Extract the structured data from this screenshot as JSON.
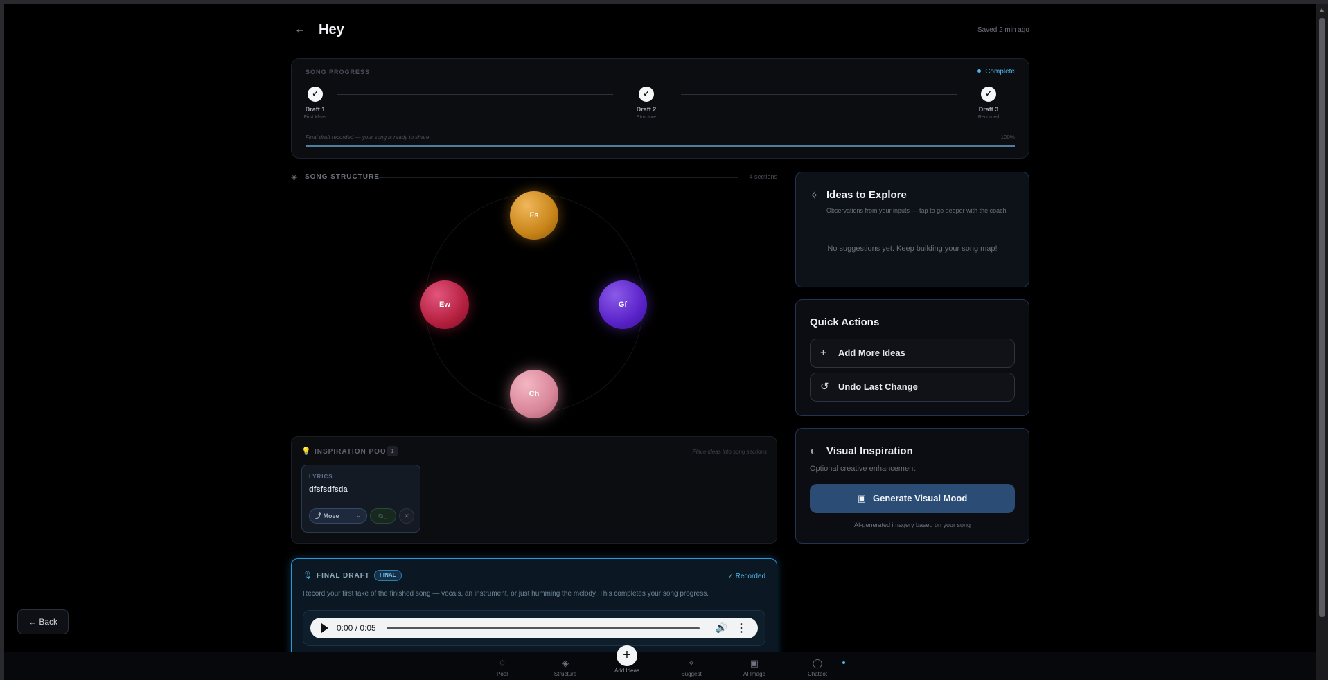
{
  "header": {
    "title": "Hey",
    "saved": "Saved 2 min ago"
  },
  "progress": {
    "label": "SONG PROGRESS",
    "status": "Complete",
    "steps": [
      {
        "name": "Draft 1",
        "sub": "First Ideas",
        "check": "✓"
      },
      {
        "name": "Draft 2",
        "sub": "Structure",
        "check": "✓"
      },
      {
        "name": "Draft 3",
        "sub": "Recorded",
        "check": "✓"
      }
    ],
    "message": "Final draft recorded — your song is ready to share",
    "percent_label": "100%",
    "percent": 100
  },
  "structure": {
    "label": "SONG STRUCTURE",
    "count": "4 sections",
    "sections": [
      {
        "abbr": "Fs",
        "color": "#c88418"
      },
      {
        "abbr": "Ew",
        "color": "#b4203f"
      },
      {
        "abbr": "Gf",
        "color": "#5a22c9"
      },
      {
        "abbr": "Ch",
        "color": "#d8869a"
      }
    ]
  },
  "pool": {
    "label": "INSPIRATION POOL",
    "count": "1",
    "hint": "Place ideas into song sections",
    "items": [
      {
        "type": "LYRICS",
        "text": "dfsfsdfsda",
        "move_label": "Move"
      }
    ]
  },
  "final_draft": {
    "label": "FINAL DRAFT",
    "badge": "FINAL",
    "recorded": "Recorded",
    "description": "Record your first take of the finished song — vocals, an instrument, or just humming the melody. This completes your song progress.",
    "audio_time": "0:00 / 0:05"
  },
  "ideas": {
    "title": "Ideas to Explore",
    "subtitle": "Observations from your inputs — tap to go deeper with the coach",
    "empty": "No suggestions yet. Keep building your song map!"
  },
  "quick_actions": {
    "title": "Quick Actions",
    "add": "Add More Ideas",
    "undo": "Undo Last Change"
  },
  "visual": {
    "title": "Visual Inspiration",
    "subtitle": "Optional creative enhancement",
    "button": "Generate Visual Mood",
    "footer": "AI-generated imagery based on your song"
  },
  "float_back": "Back",
  "nav": {
    "pool": "Pool",
    "structure": "Structure",
    "add": "Add Ideas",
    "suggest": "Suggest",
    "ai_image": "AI Image",
    "chatbot": "Chatbot"
  },
  "colors": {
    "accent": "#4db6e8",
    "primary_button": "#2b4c74"
  }
}
